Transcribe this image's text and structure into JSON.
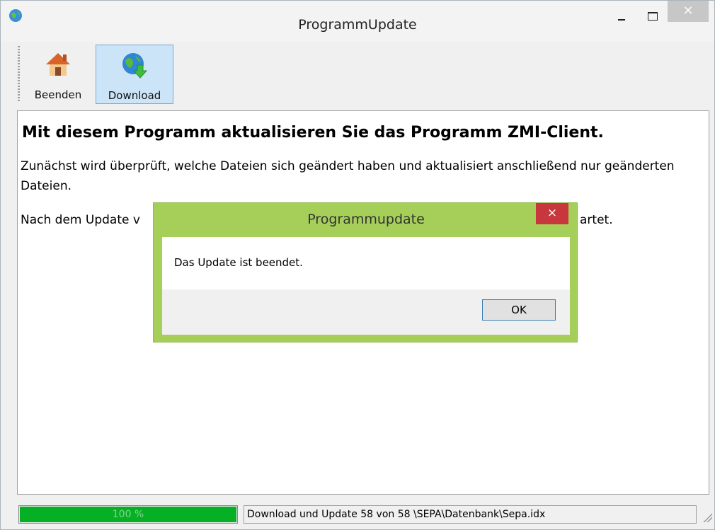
{
  "window": {
    "title": "ProgrammUpdate",
    "close_glyph": "×"
  },
  "toolbar": {
    "beenden_label": "Beenden",
    "download_label": "Download",
    "beenden_icon": "house-icon",
    "download_icon": "globe-download-icon"
  },
  "content": {
    "heading": "Mit diesem Programm aktualisieren Sie das Programm ZMI-Client.",
    "paragraph1": "Zunächst wird überprüft, welche Dateien sich geändert haben und aktualisiert anschließend nur geänderten Dateien.",
    "paragraph2_start": "Nach dem Update v",
    "paragraph2_end": "artet."
  },
  "statusbar": {
    "progress_percent": 100,
    "progress_text": "100 %",
    "message": "Download und Update 58 von 58  \\SEPA\\Datenbank\\Sepa.idx"
  },
  "dialog": {
    "title": "Programmupdate",
    "close_glyph": "×",
    "message": "Das Update ist beendet.",
    "ok_label": "OK"
  },
  "colors": {
    "dialog_frame": "#a6cf5a",
    "dialog_close": "#c7373b",
    "progress_fill": "#06b025",
    "toolbar_selected": "#cce4f7"
  }
}
